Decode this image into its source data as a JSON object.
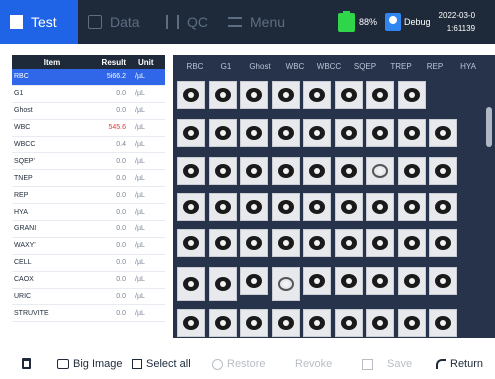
{
  "topbar": {
    "tabs": [
      {
        "label": "Test",
        "active": true
      },
      {
        "label": "Data",
        "active": false
      },
      {
        "label": "QC",
        "active": false
      },
      {
        "label": "Menu",
        "active": false
      }
    ],
    "battery": "88%",
    "user": "Debug",
    "date": "2022-03-0",
    "time": "1:61139"
  },
  "results": {
    "headers": {
      "item": "Item",
      "result": "Result",
      "unit": "Unit"
    },
    "rows": [
      {
        "item": "RBC",
        "result": "5i66.2",
        "unit": "/µL",
        "selected": true
      },
      {
        "item": "G1",
        "result": "0.0",
        "unit": "/µL"
      },
      {
        "item": "Ghost",
        "result": "0.0",
        "unit": "/µL"
      },
      {
        "item": "WBC",
        "result": "545.6",
        "unit": "/µL",
        "flag": true
      },
      {
        "item": "WBCC",
        "result": "0.4",
        "unit": "/µL"
      },
      {
        "item": "SQEP'",
        "result": "0.0",
        "unit": "/µL"
      },
      {
        "item": "TNEP",
        "result": "0.0",
        "unit": "/µL"
      },
      {
        "item": "REP",
        "result": "0.0",
        "unit": "/µL"
      },
      {
        "item": "HYA",
        "result": "0.0",
        "unit": "/µL"
      },
      {
        "item": "GRANI",
        "result": "0.0",
        "unit": "/µL"
      },
      {
        "item": "WAXY'",
        "result": "0.0",
        "unit": "/µL"
      },
      {
        "item": "CELL",
        "result": "0.0",
        "unit": "/µL"
      },
      {
        "item": "CAOX",
        "result": "0.0",
        "unit": "/µL"
      },
      {
        "item": "URIC",
        "result": "0.0",
        "unit": "/µL"
      },
      {
        "item": "STRUVITE",
        "result": "0.0",
        "unit": "/µL"
      }
    ]
  },
  "grid": {
    "categories": [
      "RBC",
      "G1",
      "Ghost",
      "WBC",
      "WBCC",
      "SQEP",
      "TREP",
      "REP",
      "HYA"
    ],
    "row_counts": [
      8,
      9,
      9,
      9,
      9,
      9,
      9
    ]
  },
  "toolbar": {
    "big_image": "Big Image",
    "select_all": "Select all",
    "restore": "Restore",
    "revoke": "Revoke",
    "save": "Save",
    "return": "Return"
  },
  "colors": {
    "active_tab": "#1f63e6",
    "topbar": "#1e2a3a",
    "grid_panel": "#27334a",
    "selected_row": "#2f67e8",
    "flag": "#e23b3b",
    "battery": "#2fd64a"
  }
}
